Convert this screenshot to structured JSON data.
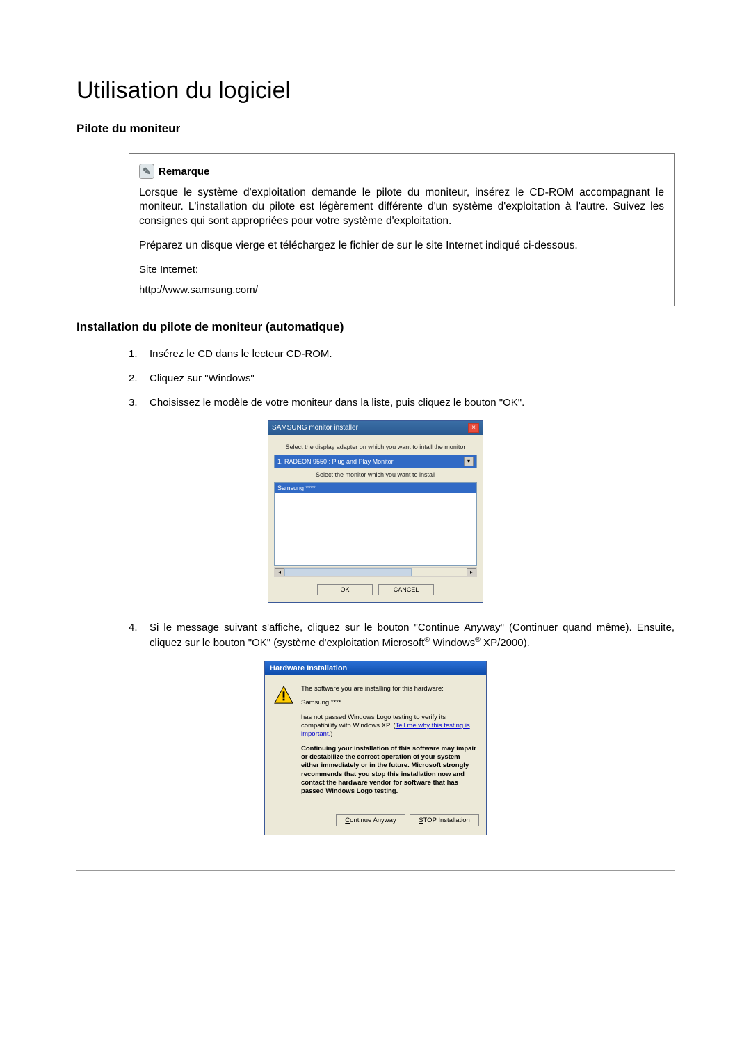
{
  "page": {
    "title": "Utilisation du logiciel",
    "section": "Pilote du moniteur"
  },
  "note": {
    "label": "Remarque",
    "paragraph1": "Lorsque le système d'exploitation demande le pilote du moniteur, insérez le CD-ROM accompagnant le moniteur. L'installation du pilote est légèrement différente d'un système d'exploitation à l'autre. Suivez les consignes qui sont appropriées pour votre système d'exploitation.",
    "paragraph2": "Préparez un disque vierge et téléchargez le fichier de sur le site Internet indiqué ci-dessous.",
    "site_label": "Site Internet:",
    "url": "http://www.samsung.com/"
  },
  "install_section": {
    "title": "Installation du pilote de moniteur (automatique)",
    "steps": [
      {
        "num": "1.",
        "text": "Insérez le CD dans le lecteur CD-ROM."
      },
      {
        "num": "2.",
        "text": "Cliquez sur \"Windows\""
      },
      {
        "num": "3.",
        "text": "Choisissez le modèle de votre moniteur dans la liste, puis cliquez le bouton \"OK\"."
      },
      {
        "num": "4.",
        "text_pre": "Si le message suivant s'affiche, cliquez sur le bouton \"Continue Anyway\" (Continuer quand même). Ensuite, cliquez sur le bouton \"OK\" (système d'exploitation Microsoft",
        "text_mid": " Windows",
        "text_post": " XP/2000)."
      }
    ]
  },
  "installer": {
    "title": "SAMSUNG monitor installer",
    "label1": "Select the display adapter on which you want to intall the monitor",
    "select_value": "1. RADEON 9550 : Plug and Play Monitor",
    "label2": "Select the monitor which you want to install",
    "list_item": "Samsung ****",
    "ok": "OK",
    "cancel": "CANCEL"
  },
  "hw": {
    "title": "Hardware Installation",
    "line1": "The software you are installing for this hardware:",
    "line2": "Samsung ****",
    "line3a": "has not passed Windows Logo testing to verify its compatibility with Windows XP. (",
    "link": "Tell me why this testing is important.",
    "line3b": ")",
    "bold": "Continuing your installation of this software may impair or destabilize the correct operation of your system either immediately or in the future. Microsoft strongly recommends that you stop this installation now and contact the hardware vendor for software that has passed Windows Logo testing.",
    "btn_continue_pre": "C",
    "btn_continue_post": "ontinue Anyway",
    "btn_stop_pre": "S",
    "btn_stop_post": "TOP Installation"
  }
}
